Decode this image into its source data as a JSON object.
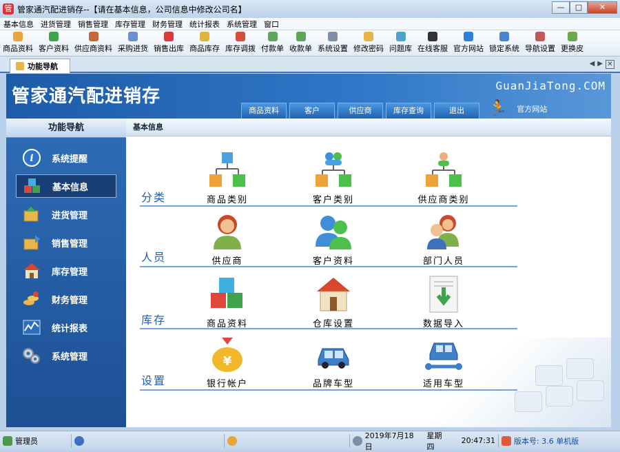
{
  "window": {
    "title": "管家通汽配进销存--【请在基本信息，公司信息中修改公司名】",
    "min_label": "—",
    "max_label": "□",
    "close_label": "✕"
  },
  "menu": [
    "基本信息",
    "进货管理",
    "销售管理",
    "库存管理",
    "财务管理",
    "统计报表",
    "系统管理",
    "窗口"
  ],
  "toolbar": [
    {
      "label": "商品资料",
      "color": "#e8a53a"
    },
    {
      "label": "客户资料",
      "color": "#3fa34d"
    },
    {
      "label": "供应商资料",
      "color": "#c7663a"
    },
    {
      "label": "采购进货",
      "color": "#6b8fcf"
    },
    {
      "label": "销售出库",
      "color": "#d93a3a"
    },
    {
      "label": "商品库存",
      "color": "#e0b53b"
    },
    {
      "label": "库存调拨",
      "color": "#d64f3a"
    },
    {
      "label": "付款单",
      "color": "#5fa65a"
    },
    {
      "label": "收款单",
      "color": "#5fa65a"
    },
    {
      "label": "系统设置",
      "color": "#7f8fa8"
    },
    {
      "label": "修改密码",
      "color": "#e5b44a"
    },
    {
      "label": "问题库",
      "color": "#4da3c9"
    },
    {
      "label": "在线客服",
      "color": "#333333"
    },
    {
      "label": "官方网站",
      "color": "#2f7fd8"
    },
    {
      "label": "锁定系统",
      "color": "#4a86d0"
    },
    {
      "label": "导航设置",
      "color": "#c05a5a"
    },
    {
      "label": "更换皮",
      "color": "#6ba84f"
    }
  ],
  "tab": {
    "label": "功能导航"
  },
  "tab_controls": {
    "left": "◀",
    "right": "▶",
    "close": "✕"
  },
  "banner": {
    "brand": "管家通汽配进销存",
    "website": "GuanJiaTong.COM",
    "tabs": [
      "商品资料",
      "客户",
      "供应商",
      "库存查询",
      "退出"
    ],
    "official": "官方网站"
  },
  "sidebar": {
    "title": "功能导航",
    "items": [
      {
        "label": "系统提醒",
        "icon": "info-icon"
      },
      {
        "label": "基本信息",
        "icon": "cubes-icon",
        "active": true
      },
      {
        "label": "进货管理",
        "icon": "box-in-icon"
      },
      {
        "label": "销售管理",
        "icon": "box-out-icon"
      },
      {
        "label": "库存管理",
        "icon": "house-icon"
      },
      {
        "label": "财务管理",
        "icon": "coins-icon"
      },
      {
        "label": "统计报表",
        "icon": "chart-icon"
      },
      {
        "label": "系统管理",
        "icon": "gears-icon"
      }
    ]
  },
  "main": {
    "header": "基本信息",
    "sections": [
      {
        "title": "分类",
        "items": [
          {
            "label": "商品类别",
            "icon": "tree-icon"
          },
          {
            "label": "客户类别",
            "icon": "people-tree-icon"
          },
          {
            "label": "供应商类别",
            "icon": "person-tree-icon"
          }
        ]
      },
      {
        "title": "人员",
        "items": [
          {
            "label": "供应商",
            "icon": "person-icon"
          },
          {
            "label": "客户资料",
            "icon": "people-icon"
          },
          {
            "label": "部门人员",
            "icon": "staff-icon"
          }
        ]
      },
      {
        "title": "库存",
        "items": [
          {
            "label": "商品资料",
            "icon": "cubes-icon"
          },
          {
            "label": "仓库设置",
            "icon": "house-icon"
          },
          {
            "label": "数据导入",
            "icon": "import-icon"
          }
        ]
      },
      {
        "title": "设置",
        "items": [
          {
            "label": "银行帐户",
            "icon": "money-bag-icon"
          },
          {
            "label": "品牌车型",
            "icon": "car-icon"
          },
          {
            "label": "适用车型",
            "icon": "car-wrench-icon"
          }
        ]
      }
    ]
  },
  "status": {
    "user": "管理员",
    "date": "2019年7月18日",
    "weekday": "星期四",
    "time": "20:47:31",
    "version": "版本号: 3.6 单机版"
  }
}
